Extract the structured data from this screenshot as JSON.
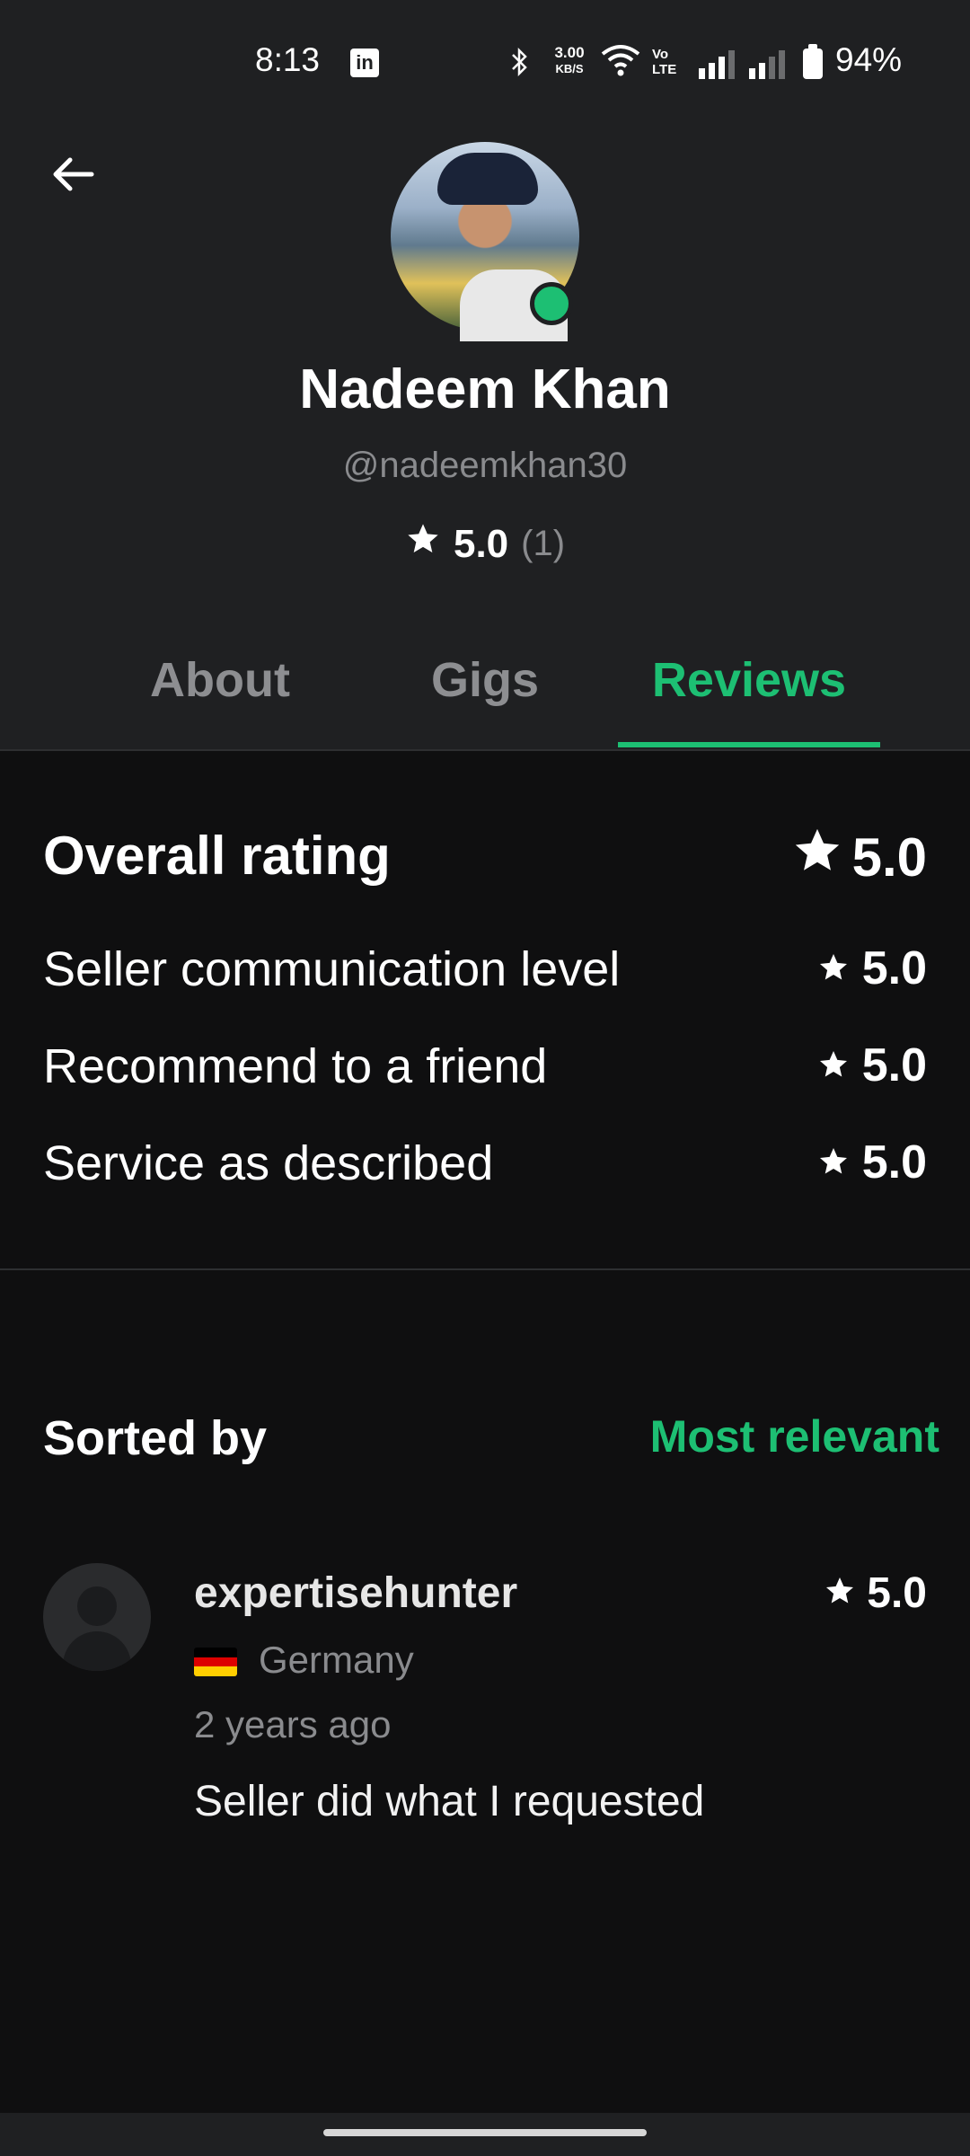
{
  "status_bar": {
    "time": "8:13",
    "app_icon": "linkedin-icon",
    "network_speed_value": "3.00",
    "network_speed_unit": "KB/S",
    "volte_top": "Vo",
    "volte_bottom": "LTE",
    "battery": "94%"
  },
  "profile": {
    "name": "Nadeem Khan",
    "handle": "@nadeemkhan30",
    "rating": "5.0",
    "rating_count": "(1)",
    "online_color": "#1dbf73"
  },
  "tabs": [
    {
      "label": "About",
      "active": false
    },
    {
      "label": "Gigs",
      "active": false
    },
    {
      "label": "Reviews",
      "active": true
    }
  ],
  "ratings": {
    "overall_label": "Overall rating",
    "overall_value": "5.0",
    "items": [
      {
        "label": "Seller communication level",
        "value": "5.0"
      },
      {
        "label": "Recommend to a friend",
        "value": "5.0"
      },
      {
        "label": "Service as described",
        "value": "5.0"
      }
    ]
  },
  "sort": {
    "label": "Sorted by",
    "value": "Most relevant"
  },
  "reviews": [
    {
      "user": "expertisehunter",
      "country": "Germany",
      "time": "2 years ago",
      "rating": "5.0",
      "text": "Seller did what I requested"
    }
  ],
  "colors": {
    "accent": "#1dbf73",
    "header_bg": "#1f2022",
    "body_bg": "#0f0f10"
  }
}
